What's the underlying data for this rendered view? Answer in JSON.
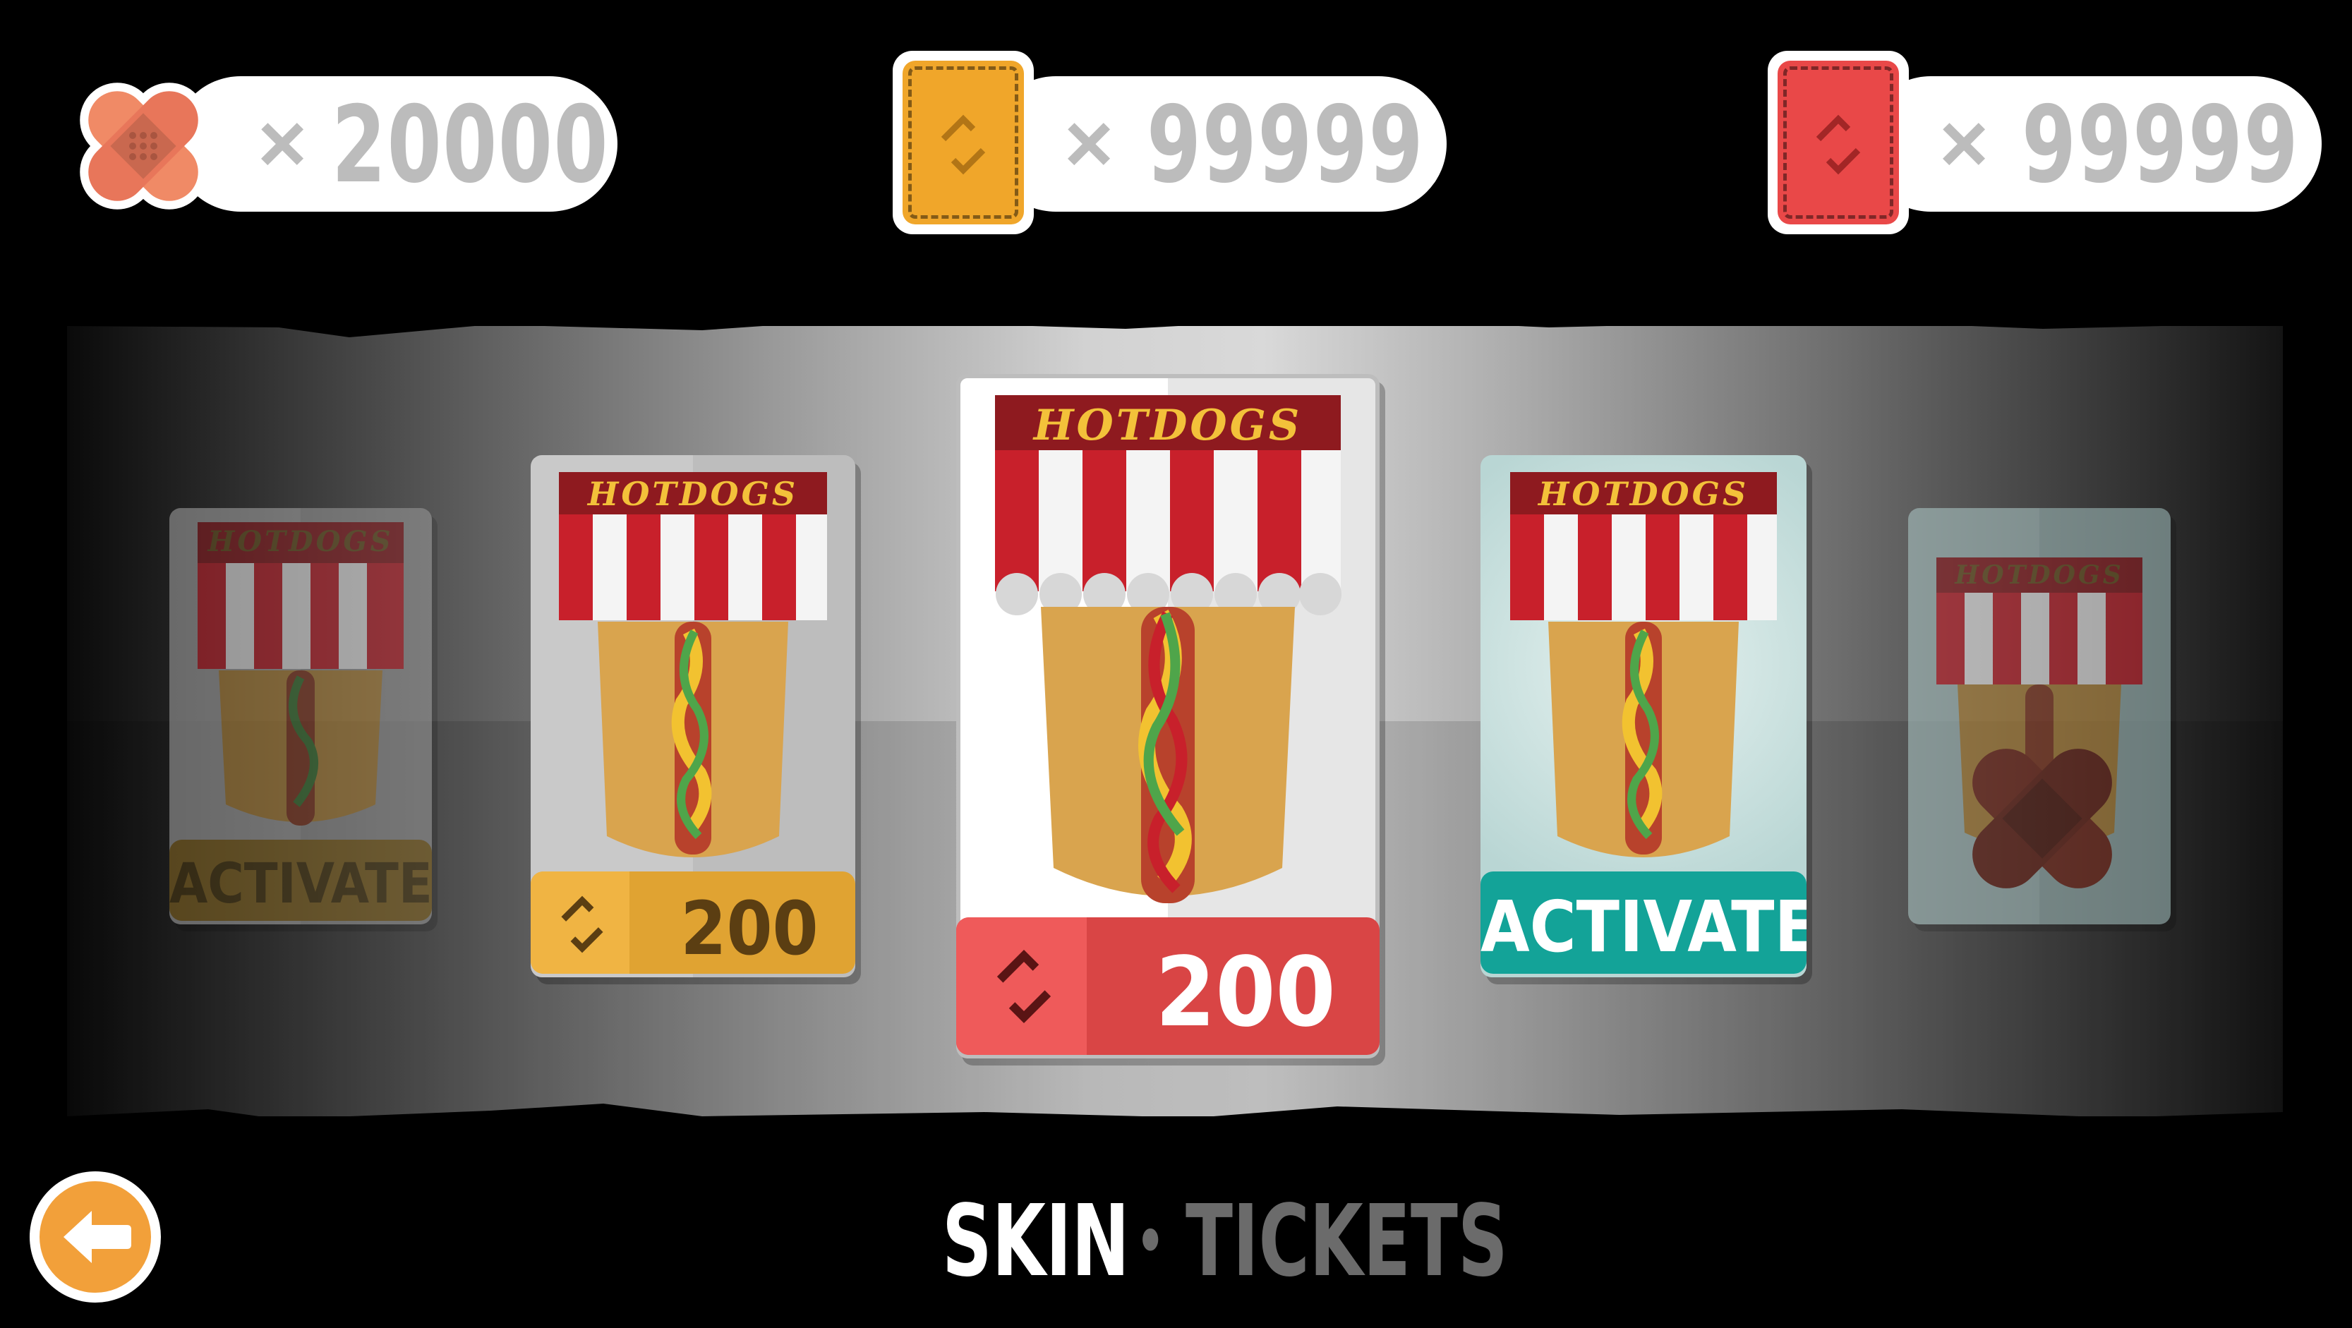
{
  "currencies": {
    "bandages": {
      "icon": "bandage-icon",
      "count": "20000",
      "times": "×"
    },
    "gold_tickets": {
      "icon": "gold-ticket-icon",
      "count": "99999",
      "times": "×"
    },
    "red_tickets": {
      "icon": "red-ticket-icon",
      "count": "99999",
      "times": "×"
    }
  },
  "cards": [
    {
      "title": "HOTDOGS",
      "button_label": "ACTIVATE",
      "button_color": "#b8892b",
      "state": "dimmed"
    },
    {
      "title": "HOTDOGS",
      "button_label": "200",
      "button_icon": "ticket-arrow-icon",
      "button_color": "#e0a332",
      "state": "for-sale"
    },
    {
      "title": "HOTDOGS",
      "button_label": "200",
      "button_icon": "ticket-arrow-icon",
      "button_color": "#ef4b4b",
      "state": "selected"
    },
    {
      "title": "HOTDOGS",
      "button_label": "ACTIVATE",
      "button_color": "#13a398",
      "state": "owned"
    },
    {
      "title": "HOTDOGS",
      "state": "locked",
      "overlay_icon": "bandage-icon"
    }
  ],
  "nav": {
    "back_icon": "arrow-left-icon",
    "active_tab": "SKIN",
    "separator": "•",
    "inactive_tab": "TICKETS"
  },
  "colors": {
    "awning_red": "#c8202b",
    "awning_dark": "#8e1a1f",
    "title_gold": "#f3c13a",
    "bun": "#d9a44e",
    "sausage": "#b8422c",
    "mustard": "#f2c230",
    "relish": "#4fa54a"
  }
}
